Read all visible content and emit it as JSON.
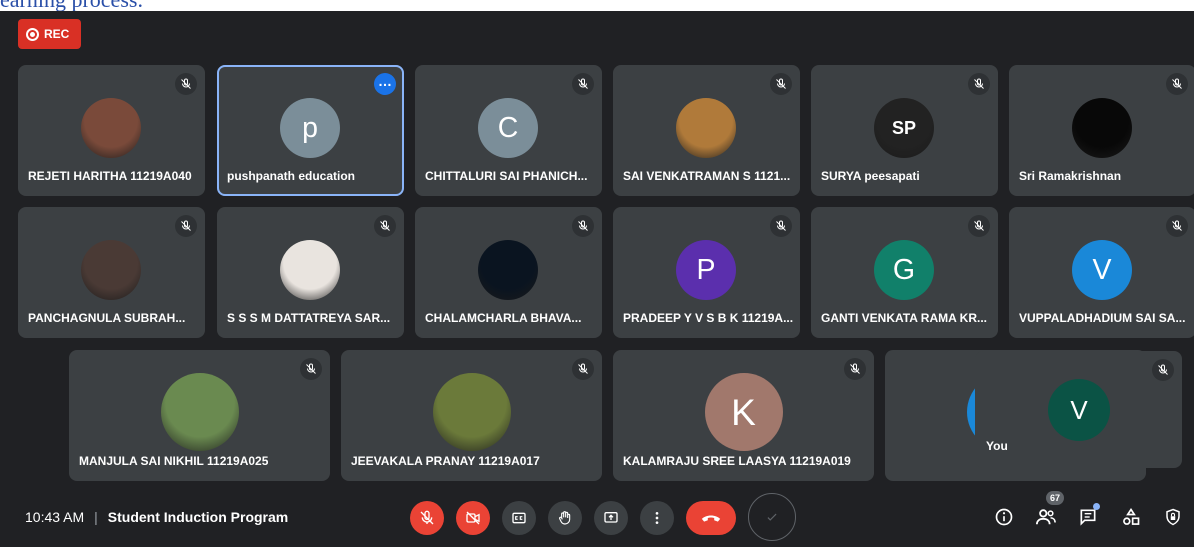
{
  "page_top_text": "earning process.",
  "recording": {
    "label": "REC"
  },
  "participants": [
    {
      "name": "REJETI HARITHA 11219A040",
      "avatar_type": "photo",
      "photo_tone": "#7a4a3a"
    },
    {
      "name": "pushpanath education",
      "avatar_type": "letter",
      "letter": "p",
      "color": "#7b8e99",
      "active": true
    },
    {
      "name": "CHITTALURI SAI PHANICH...",
      "avatar_type": "letter",
      "letter": "C",
      "color": "#7b8e99"
    },
    {
      "name": "SAI VENKATRAMAN S 1121...",
      "avatar_type": "photo",
      "photo_tone": "#b07a3a"
    },
    {
      "name": "SURYA peesapati",
      "avatar_type": "photo",
      "photo_tone": "#222222",
      "logo_text": "SP"
    },
    {
      "name": "Sri Ramakrishnan",
      "avatar_type": "photo",
      "photo_tone": "#080808"
    },
    {
      "name": "PANCHAGNULA SUBRAH...",
      "avatar_type": "photo",
      "photo_tone": "#4a3a35"
    },
    {
      "name": "S S S M DATTATREYA SAR...",
      "avatar_type": "photo",
      "photo_tone": "#e9e4df"
    },
    {
      "name": "CHALAMCHARLA BHAVA...",
      "avatar_type": "photo",
      "photo_tone": "#0a1420"
    },
    {
      "name": "PRADEEP Y V S B K 11219A...",
      "avatar_type": "letter",
      "letter": "P",
      "color": "#5b2fad"
    },
    {
      "name": "GANTI VENKATA RAMA KR...",
      "avatar_type": "letter",
      "letter": "G",
      "color": "#11806a"
    },
    {
      "name": "VUPPALADHADIUM SAI SA...",
      "avatar_type": "letter",
      "letter": "V",
      "color": "#1a88d8"
    },
    {
      "name": "MANJULA SAI NIKHIL 11219A025",
      "avatar_type": "photo",
      "photo_tone": "#6a8a50"
    },
    {
      "name": "JEEVAKALA PRANAY 11219A017",
      "avatar_type": "photo",
      "photo_tone": "#6b7a3a"
    },
    {
      "name": "KALAMRAJU SREE LAASYA 11219A019",
      "avatar_type": "letter",
      "letter": "K",
      "color": "#a1786c"
    }
  ],
  "self_view": {
    "label": "You",
    "letter": "V",
    "color": "#0b5345"
  },
  "meeting": {
    "time": "10:43 AM",
    "separator": "|",
    "title": "Student Induction Program"
  },
  "controls": {
    "mic": {
      "icon": "mic-off-icon",
      "state": "off"
    },
    "camera": {
      "icon": "camera-off-icon",
      "state": "off"
    },
    "captions": {
      "icon": "captions-icon"
    },
    "raise_hand": {
      "icon": "hand-icon"
    },
    "present": {
      "icon": "present-screen-icon"
    },
    "more": {
      "icon": "more-vert-icon"
    },
    "leave": {
      "icon": "hangup-icon"
    },
    "check": {
      "icon": "check-icon"
    }
  },
  "right_controls": {
    "people_count": "67"
  },
  "colors": {
    "background": "#202124",
    "tile": "#3c4043",
    "red": "#ea4335",
    "accent": "#8ab4f8"
  }
}
